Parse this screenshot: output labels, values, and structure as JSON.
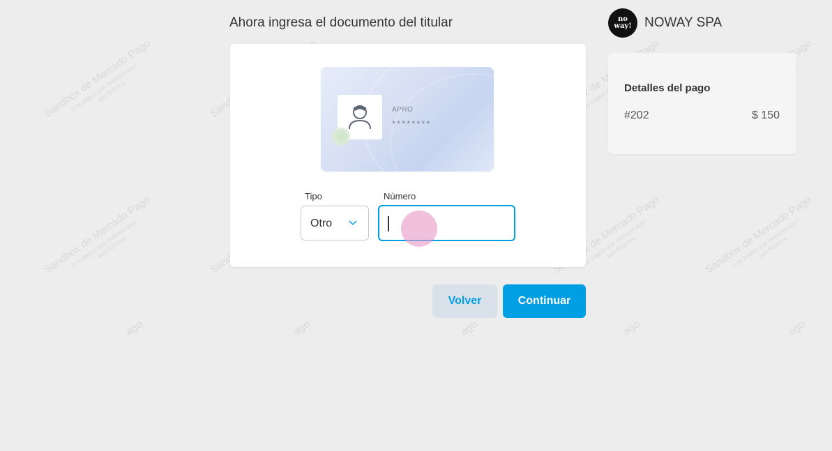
{
  "page_title": "Ahora ingresa el documento del titular",
  "merchant": {
    "logo_text": "no way!",
    "name": "NOWAY SPA"
  },
  "id_card": {
    "name": "APRO",
    "masked_number": "********"
  },
  "form": {
    "type_label": "Tipo",
    "type_value": "Otro",
    "number_label": "Número",
    "number_value": ""
  },
  "buttons": {
    "back": "Volver",
    "continue": "Continuar"
  },
  "summary": {
    "title": "Detalles del pago",
    "reference": "#202",
    "amount": "$ 150"
  },
  "watermark": {
    "line1": "Sandbox de Mercado Pago",
    "line2": "Los pagos que realices aquí",
    "line3": "son ficticios.",
    "fragment": "ago"
  },
  "colors": {
    "primary": "#009ee3",
    "background": "#ededed",
    "secondary_button": "#d9e1ea"
  }
}
